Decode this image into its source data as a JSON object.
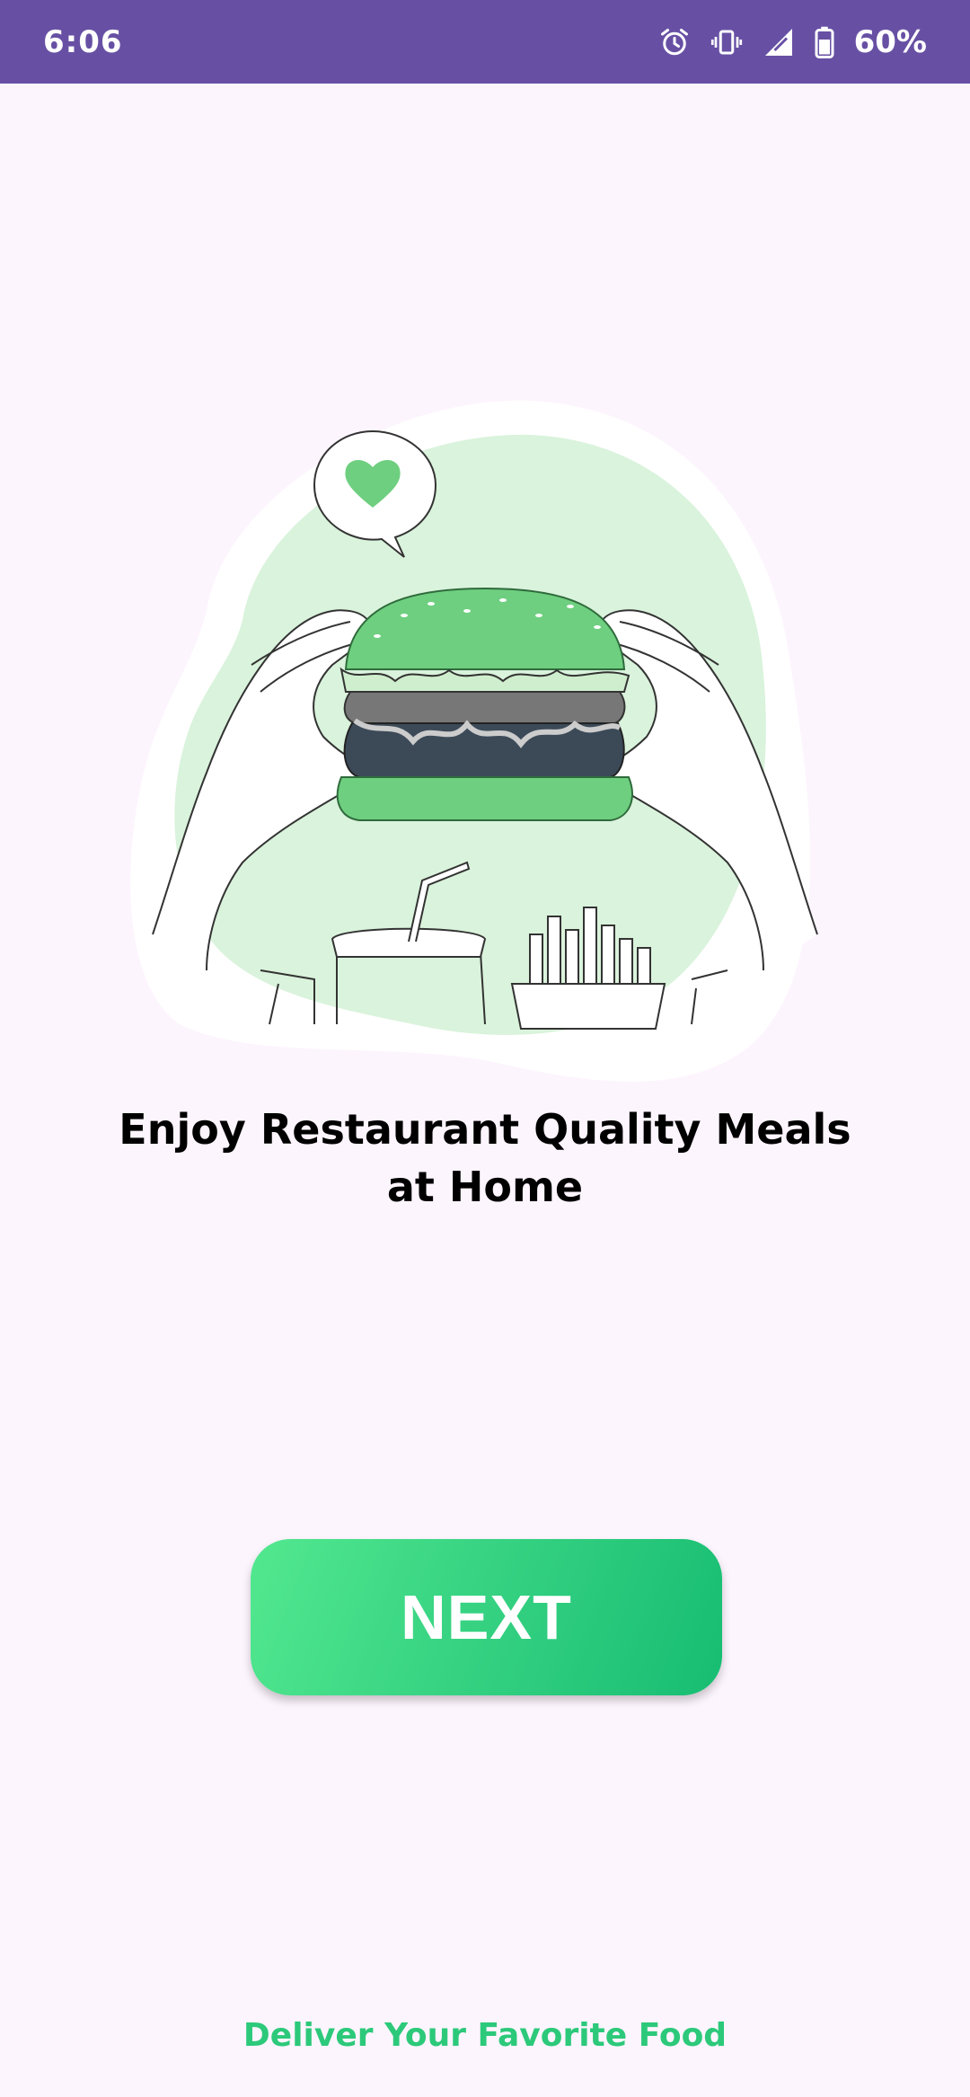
{
  "status_bar": {
    "time": "6:06",
    "battery_percent": "60%",
    "icons": [
      "alarm-icon",
      "vibrate-icon",
      "signal-icon",
      "battery-icon"
    ]
  },
  "onboarding": {
    "illustration_icon": "burger-illustration",
    "title_line1": "Enjoy Restaurant Quality Meals",
    "title_line2": "at Home",
    "next_label": "NEXT",
    "tagline": "Deliver Your Favorite Food"
  },
  "colors": {
    "status_bar": "#6750a4",
    "background": "#fdf5fd",
    "accent_green": "#2cc97a",
    "button_start": "#52e88f",
    "button_end": "#17bd72"
  }
}
